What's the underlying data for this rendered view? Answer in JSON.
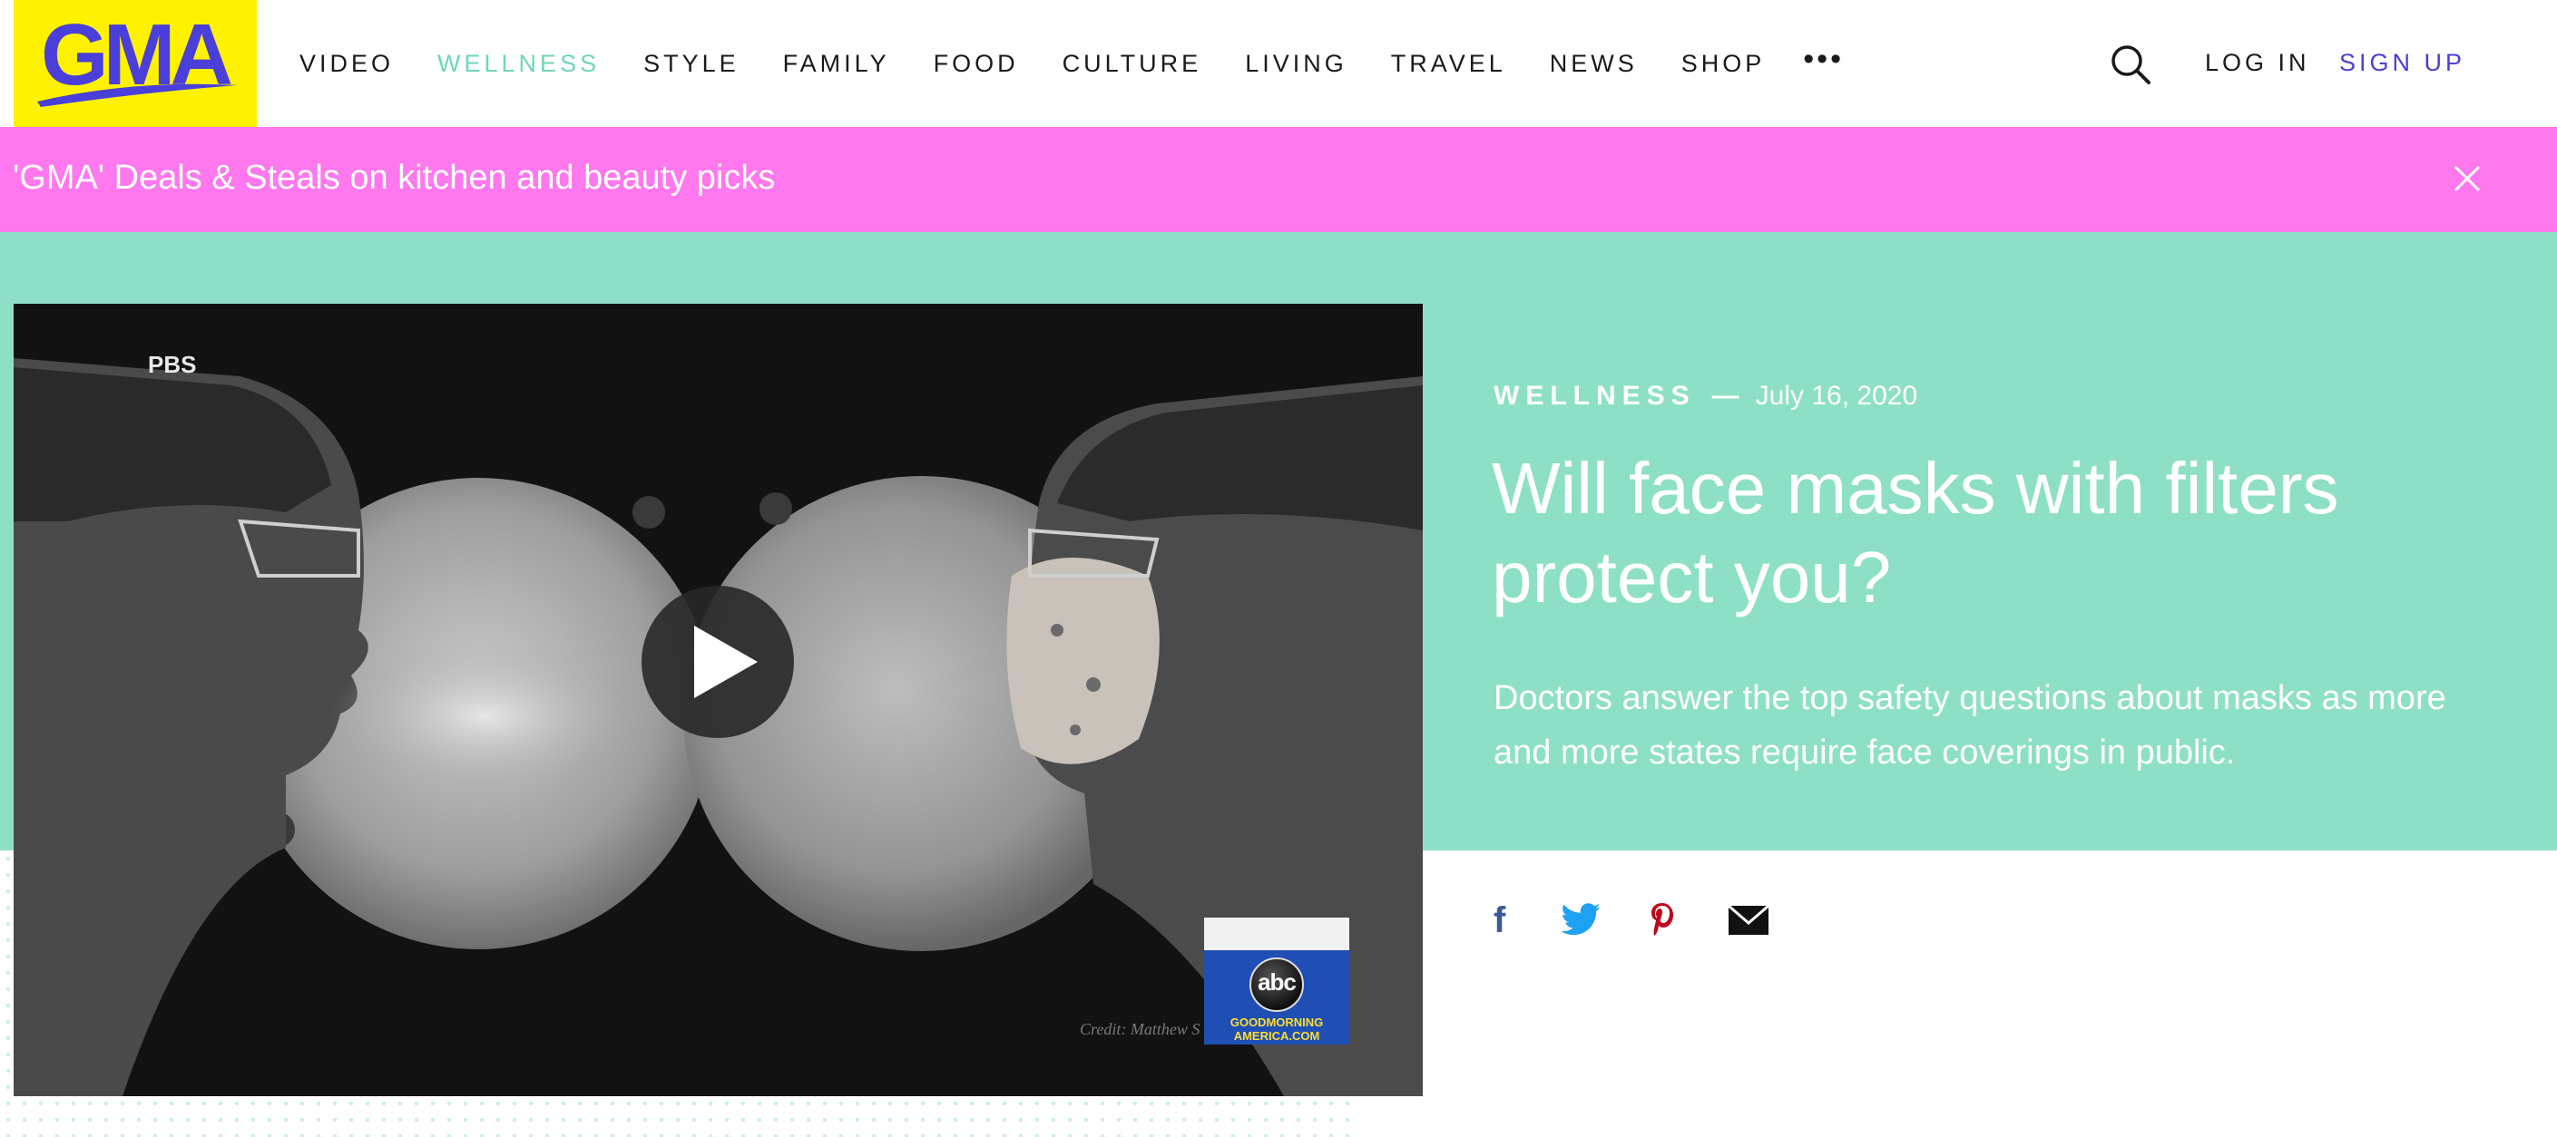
{
  "header": {
    "logo_text": "GMA",
    "nav": [
      {
        "label": "VIDEO",
        "active": false
      },
      {
        "label": "WELLNESS",
        "active": true
      },
      {
        "label": "STYLE",
        "active": false
      },
      {
        "label": "FAMILY",
        "active": false
      },
      {
        "label": "FOOD",
        "active": false
      },
      {
        "label": "CULTURE",
        "active": false
      },
      {
        "label": "LIVING",
        "active": false
      },
      {
        "label": "TRAVEL",
        "active": false
      },
      {
        "label": "NEWS",
        "active": false
      },
      {
        "label": "SHOP",
        "active": false
      }
    ],
    "more_label": "•••",
    "search_icon": "search-icon",
    "login_label": "LOG IN",
    "signup_label": "SIGN UP"
  },
  "banner": {
    "text": "'GMA' Deals & Steals on kitchen and beauty picks",
    "close_icon": "close-icon"
  },
  "video": {
    "source_label": "PBS",
    "credit": "Credit: Matthew S",
    "network_logo": "abc",
    "network_caption": "GOODMORNING AMERICA.COM",
    "play_icon": "play-icon"
  },
  "article": {
    "category": "WELLNESS",
    "separator": "—",
    "date": "July 16, 2020",
    "headline": "Will face masks with filters protect you?",
    "dek": "Doctors answer the top safety questions about masks as more and more states require face coverings in public."
  },
  "share": [
    "facebook-icon",
    "twitter-icon",
    "pinterest-icon",
    "email-icon"
  ],
  "colors": {
    "logo_bg": "#fff200",
    "brand_purple": "#4a3fd8",
    "nav_active": "#6fd6bb",
    "banner_bg": "#ff78ee",
    "hero_bg": "#8de0c6",
    "facebook": "#3b5998",
    "twitter": "#1da1f2",
    "pinterest": "#bd081c"
  }
}
